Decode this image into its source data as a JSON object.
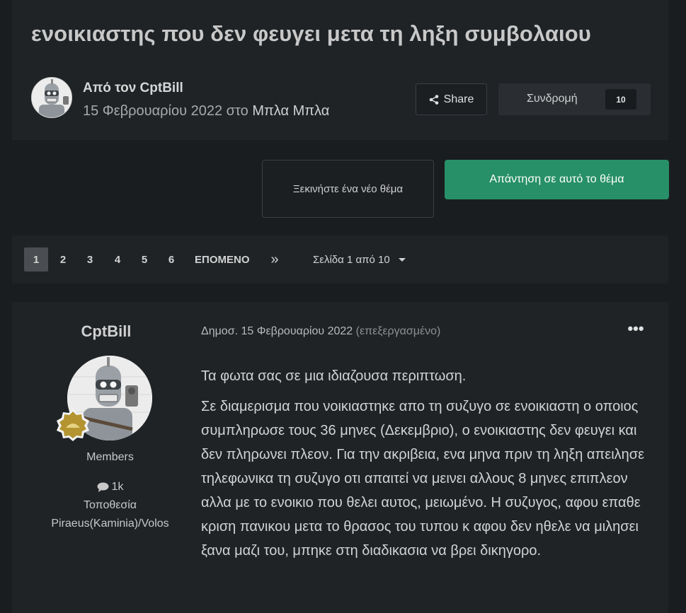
{
  "topic": {
    "title": "ενοικιαστης που δεν φευγει μετα τη ληξη συμβολαιου",
    "by_line": "Από τον CptBill",
    "date_text": "15 Φεβρουαρίου 2022 στο ",
    "forum": "Μπλα Μπλα"
  },
  "actions": {
    "share_label": "Share",
    "follow_label": "Συνδρομή",
    "follow_count": "10",
    "new_topic_label": "Ξεκινήστε ένα νέο θέμα",
    "reply_label": "Απάντηση σε αυτό το θέμα"
  },
  "pagination": {
    "pages": [
      "1",
      "2",
      "3",
      "4",
      "5",
      "6"
    ],
    "next_label": "ΕΠΟΜΕΝΟ",
    "last_label": "»",
    "jump_label": "Σελίδα 1 από 10"
  },
  "post": {
    "author": "CptBill",
    "group": "Members",
    "post_count": "1k",
    "location_label": "Τοποθεσία",
    "location": "Piraeus(Kaminia)/Volos",
    "posted_text": "Δημοσ. 15 Φεβρουαρίου 2022 ",
    "edited_text": "(επεξεργασμένο)",
    "paragraphs": [
      "Τα φωτα σας σε μια ιδιαζουσα περιπτωση.",
      "Σε διαμερισμα που νοικιαστηκε απο τη συζυγο σε ενοικιαστη ο οποιος συμπληρωσε τους 36 μηνες (Δεκεμβριο), ο ενοικιαστης δεν φευγει και δεν πληρωνει πλεον. Για την ακριβεια, ενα μηνα πριν τη ληξη απειλησε τηλεφωνικα τη συζυγο οτι απαιτεί να μεινει αλλους 8 μηνες επιπλεον αλλα με το ενοικιο που θελει αυτος, μειωμένο. Η συζυγος, αφου επαθε κριση πανικου μετα το θρασος του τυπου κ αφου δεν ηθελε να μιλησει ξανα μαζι του, μπηκε στη διαδικασια να βρει δικηγορο."
    ]
  },
  "colors": {
    "background": "#1a1d20",
    "panel": "#1f2326",
    "accent_green": "#279068"
  },
  "icons": [
    "share-icon",
    "comment-icon",
    "ellipsis-icon",
    "rank-badge-icon"
  ]
}
